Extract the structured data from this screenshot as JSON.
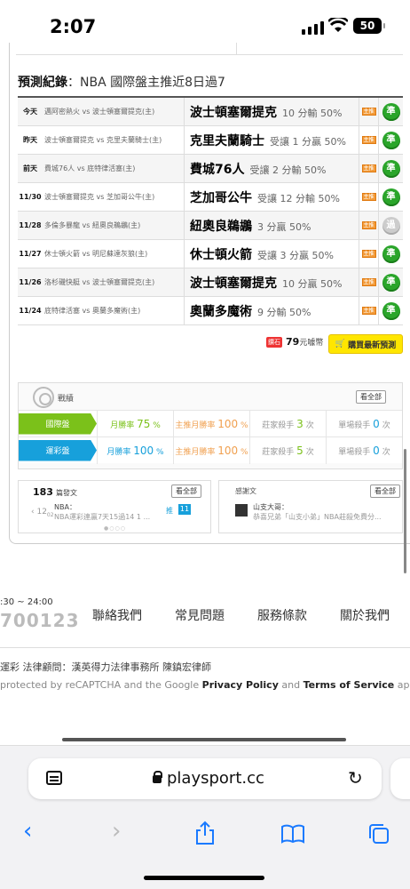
{
  "status": {
    "time": "2:07",
    "battery": "50"
  },
  "section_title": {
    "bold": "預測紀錄",
    "rest": "：NBA 國際盤主推近8日過7"
  },
  "predictions": [
    {
      "date": "今天",
      "match": "邁阿密熱火 vs 波士頓塞爾提克(主)",
      "pick": "波士頓塞爾提克",
      "odds": "10 分輸 50%",
      "tag": "主推",
      "result": "準"
    },
    {
      "date": "昨天",
      "match": "波士頓塞爾提克 vs 克里夫蘭騎士(主)",
      "pick": "克里夫蘭騎士",
      "odds": "受讓 1 分贏 50%",
      "tag": "主推",
      "result": "準"
    },
    {
      "date": "前天",
      "match": "費城76人 vs 底特律活塞(主)",
      "pick": "費城76人",
      "odds": "受讓 2 分輸 50%",
      "tag": "主推",
      "result": "準"
    },
    {
      "date": "11/30",
      "match": "波士頓塞爾提克 vs 芝加哥公牛(主)",
      "pick": "芝加哥公牛",
      "odds": "受讓 12 分輸 50%",
      "tag": "主推",
      "result": "準"
    },
    {
      "date": "11/28",
      "match": "多倫多暴龍 vs 紐奧良鵜鶘(主)",
      "pick": "紐奧良鵜鶘",
      "odds": "3 分贏 50%",
      "tag": "主推",
      "result": "過"
    },
    {
      "date": "11/27",
      "match": "休士頓火箭 vs 明尼蘇達灰狼(主)",
      "pick": "休士頓火箭",
      "odds": "受讓 3 分贏 50%",
      "tag": "主推",
      "result": "準"
    },
    {
      "date": "11/26",
      "match": "洛杉磯快艇 vs 波士頓塞爾提克(主)",
      "pick": "波士頓塞爾提克",
      "odds": "10 分贏 50%",
      "tag": "主推",
      "result": "準"
    },
    {
      "date": "11/24",
      "match": "底特律活塞 vs 奧蘭多魔術(主)",
      "pick": "奧蘭多魔術",
      "odds": "9 分輸 50%",
      "tag": "主推",
      "result": "準"
    }
  ],
  "buy": {
    "coin_label": "鑽石",
    "coins": "79",
    "coins_unit": "元噱幣",
    "button": "購買最新預測"
  },
  "record": {
    "title": "戰績",
    "see_all": "看全部",
    "rows": [
      {
        "label": "國際盤",
        "month_rate": "月勝率",
        "month_val": "75",
        "main_rate": "主推月勝率",
        "main_val": "100",
        "kill": "莊家殺手",
        "kill_val": "3",
        "single": "單場殺手",
        "single_val": "0"
      },
      {
        "label": "運彩盤",
        "month_rate": "月勝率",
        "month_val": "100",
        "main_rate": "主推月勝率",
        "main_val": "100",
        "kill": "莊家殺手",
        "kill_val": "5",
        "single": "單場殺手",
        "single_val": "0"
      }
    ],
    "pct": "%",
    "times": "次"
  },
  "posts": {
    "count": "183",
    "count_label": "篇發文",
    "see_all": "看全部",
    "month": "12",
    "day": "02",
    "title": "NBA：",
    "sub": "NBA運彩連贏7天15過14 1 ...",
    "tui": "推",
    "tui_n": "11"
  },
  "thanks": {
    "title": "感謝文",
    "see_all": "看全部",
    "name": "山支大哥：",
    "sub": "恭喜兄弟「山支小弟」NBA莊殺免費分..."
  },
  "footer": {
    "hours": ":30 ~ 24:00",
    "phone": "700123",
    "links": [
      "聯絡我們",
      "常見問題",
      "服務條款",
      "關於我們"
    ],
    "legal": "運彩 法律顧問：漢英得力法律事務所 陳鎮宏律師",
    "captcha_a": "protected by reCAPTCHA and the Google ",
    "captcha_pp": "Privacy Policy",
    "captcha_and": " and ",
    "captcha_tos": "Terms of Service",
    "captcha_b": " apply."
  },
  "browser": {
    "url": "playsport.cc"
  }
}
